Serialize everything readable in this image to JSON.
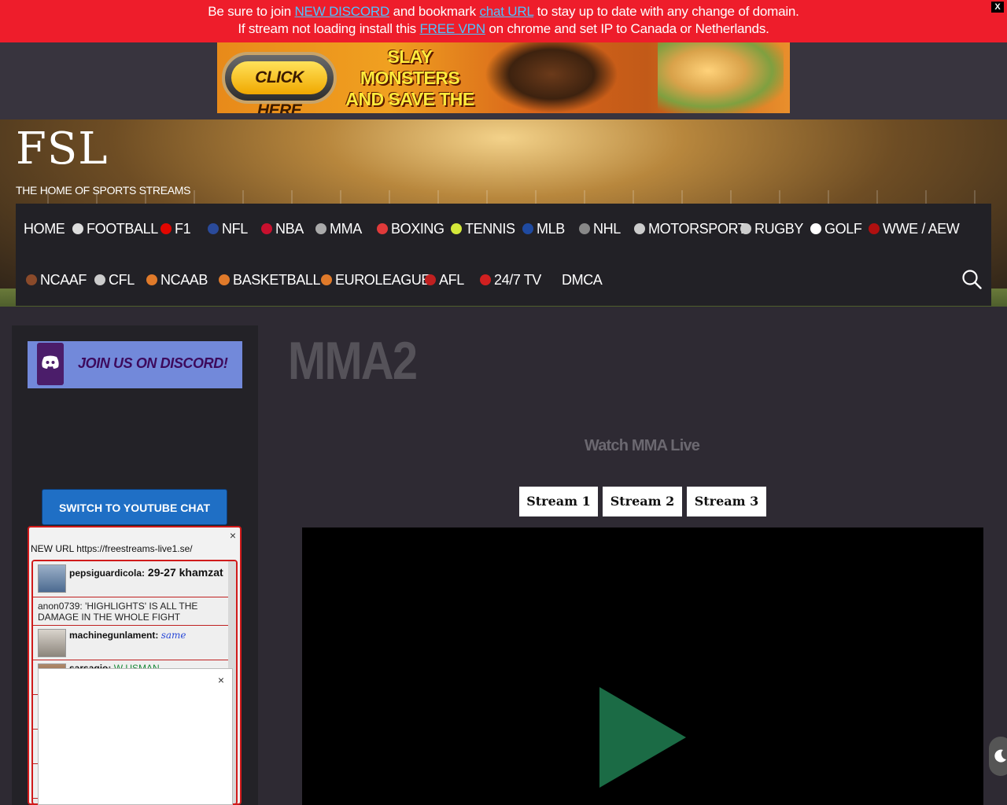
{
  "notice": {
    "line1_pre": "Be sure to join ",
    "line1_link1": "NEW DISCORD",
    "line1_mid": " and bookmark ",
    "line1_link2": "chat URL",
    "line1_post": " to stay up to date with any change of domain.",
    "line2_pre": "If stream not loading install this ",
    "line2_link": "FREE VPN",
    "line2_post": " on chrome and set IP to Canada or Netherlands.",
    "close": "X"
  },
  "ad": {
    "button": "CLICK HERE",
    "headline": "SLAY MONSTERS AND SAVE THE GIRL TODAY!"
  },
  "site": {
    "title": "FSL",
    "tagline": "THE HOME OF SPORTS STREAMS"
  },
  "nav": {
    "row1": [
      {
        "label": "HOME",
        "icon": ""
      },
      {
        "label": "FOOTBALL",
        "icon": "soccer-ball-icon"
      },
      {
        "label": "F1",
        "icon": "f1-icon"
      },
      {
        "label": "NFL",
        "icon": "nfl-icon"
      },
      {
        "label": "NBA",
        "icon": "nba-icon"
      },
      {
        "label": "MMA",
        "icon": "fist-icon"
      },
      {
        "label": "BOXING",
        "icon": "boxing-glove-icon"
      },
      {
        "label": "TENNIS",
        "icon": "tennis-ball-icon"
      },
      {
        "label": "MLB",
        "icon": "mlb-icon"
      },
      {
        "label": "NHL",
        "icon": "nhl-icon"
      },
      {
        "label": "MOTORSPORT",
        "icon": "checkered-flag-icon"
      },
      {
        "label": "RUGBY",
        "icon": "rugby-ball-icon"
      },
      {
        "label": "GOLF",
        "icon": "golf-ball-icon"
      },
      {
        "label": "WWE / AEW",
        "icon": "wwe-icon"
      }
    ],
    "row2": [
      {
        "label": "NCAAF",
        "icon": "american-football-icon"
      },
      {
        "label": "CFL",
        "icon": "cfl-icon"
      },
      {
        "label": "NCAAB",
        "icon": "basketball-icon"
      },
      {
        "label": "BASKETBALL",
        "icon": "basketball-icon"
      },
      {
        "label": "EUROLEAGUE",
        "icon": "basketball-icon"
      },
      {
        "label": "AFL",
        "icon": "afl-icon"
      },
      {
        "label": "24/7 TV",
        "icon": "tv-icon"
      },
      {
        "label": "DMCA",
        "icon": ""
      }
    ]
  },
  "sidebar": {
    "discord": "JOIN US ON DISCORD!",
    "switch_chat": "SWITCH TO YOUTUBE CHAT",
    "chat_close": "×",
    "chat_notice": "NEW URL https://freestreams-live1.se/",
    "messages": [
      {
        "user": "pepsiguardicola:",
        "text": "29-27 khamzat"
      },
      {
        "user": "anon0739:",
        "text": "'HIGHLIGHTS' IS ALL THE DAMAGE IN THE WHOLE FIGHT"
      },
      {
        "user": "machinegunlament:",
        "text": "same"
      },
      {
        "user": "sarsagio:",
        "text": "W USMAN"
      }
    ],
    "popup_close": "×"
  },
  "main": {
    "title": "MMA2",
    "subtitle": "Watch MMA Live",
    "streams": [
      "Stream 1",
      "Stream 2",
      "Stream 3"
    ]
  },
  "colors": {
    "notice_bg": "#ee1d2b",
    "link": "#4fc3ff",
    "nav_bg": "#222126",
    "play": "#1b6b45",
    "chat_border": "#d01a1a"
  }
}
